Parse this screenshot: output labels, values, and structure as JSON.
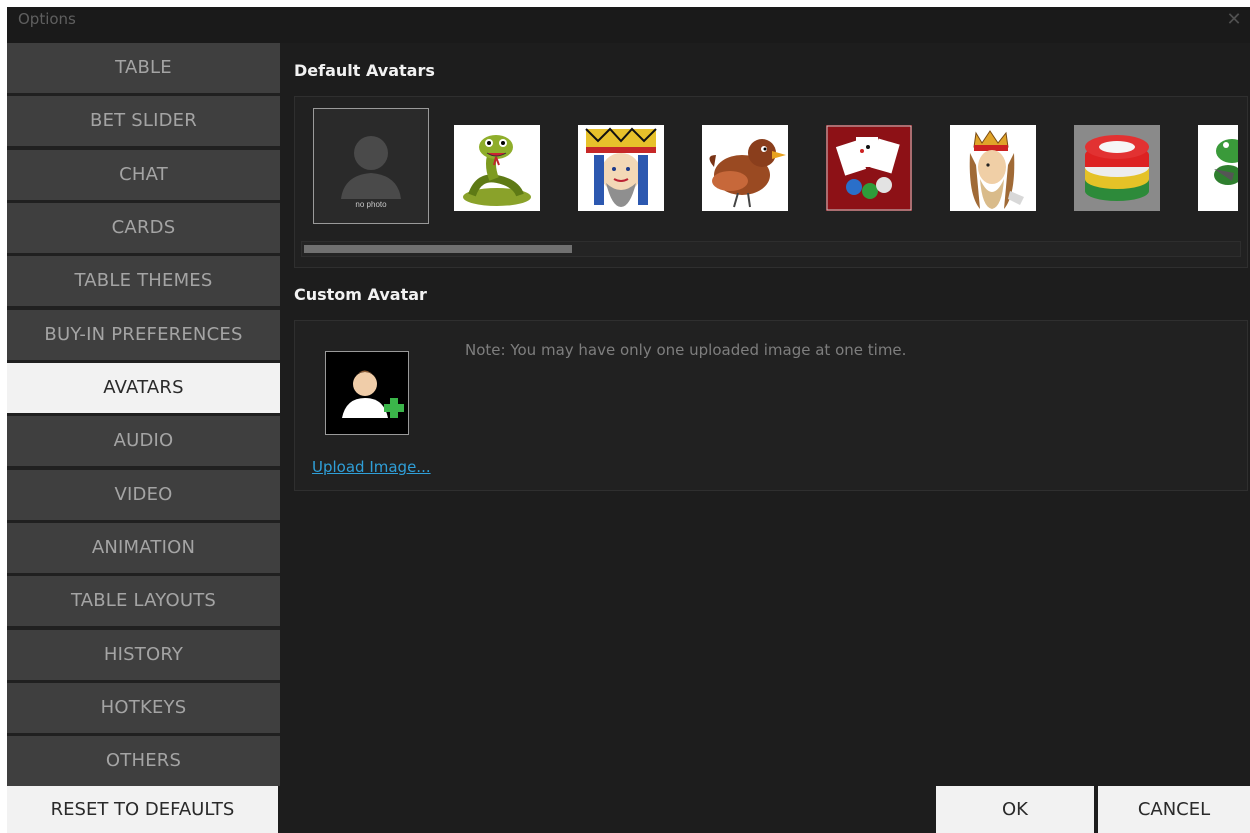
{
  "window": {
    "title": "Options",
    "close_glyph": "✕"
  },
  "sidebar": {
    "items": [
      {
        "label": "TABLE",
        "active": false
      },
      {
        "label": "BET SLIDER",
        "active": false
      },
      {
        "label": "CHAT",
        "active": false
      },
      {
        "label": "CARDS",
        "active": false
      },
      {
        "label": "TABLE THEMES",
        "active": false
      },
      {
        "label": "BUY-IN PREFERENCES",
        "active": false
      },
      {
        "label": "AVATARS",
        "active": true
      },
      {
        "label": "AUDIO",
        "active": false
      },
      {
        "label": "VIDEO",
        "active": false
      },
      {
        "label": "ANIMATION",
        "active": false
      },
      {
        "label": "TABLE LAYOUTS",
        "active": false
      },
      {
        "label": "HISTORY",
        "active": false
      },
      {
        "label": "HOTKEYS",
        "active": false
      },
      {
        "label": "OTHERS",
        "active": false
      }
    ]
  },
  "default_avatars": {
    "title": "Default Avatars",
    "selected": "no-photo",
    "items": [
      {
        "name": "no-photo",
        "caption": "no photo"
      },
      {
        "name": "snake"
      },
      {
        "name": "king-card"
      },
      {
        "name": "bird"
      },
      {
        "name": "playing-cards-chips"
      },
      {
        "name": "king-portrait"
      },
      {
        "name": "poker-chip-stack"
      },
      {
        "name": "green-frog-partial"
      }
    ]
  },
  "custom_avatar": {
    "title": "Custom Avatar",
    "note": "Note: You may have only one uploaded image at one time.",
    "upload_label": "Upload Image...",
    "icon": "add-user-icon"
  },
  "footer": {
    "reset_label": "RESET TO DEFAULTS",
    "ok_label": "OK",
    "cancel_label": "CANCEL"
  },
  "colors": {
    "window_bg": "#1d1d1d",
    "nav_item_bg": "#3f3f3f",
    "nav_active_bg": "#f2f2f2",
    "link": "#2f9fd8"
  }
}
